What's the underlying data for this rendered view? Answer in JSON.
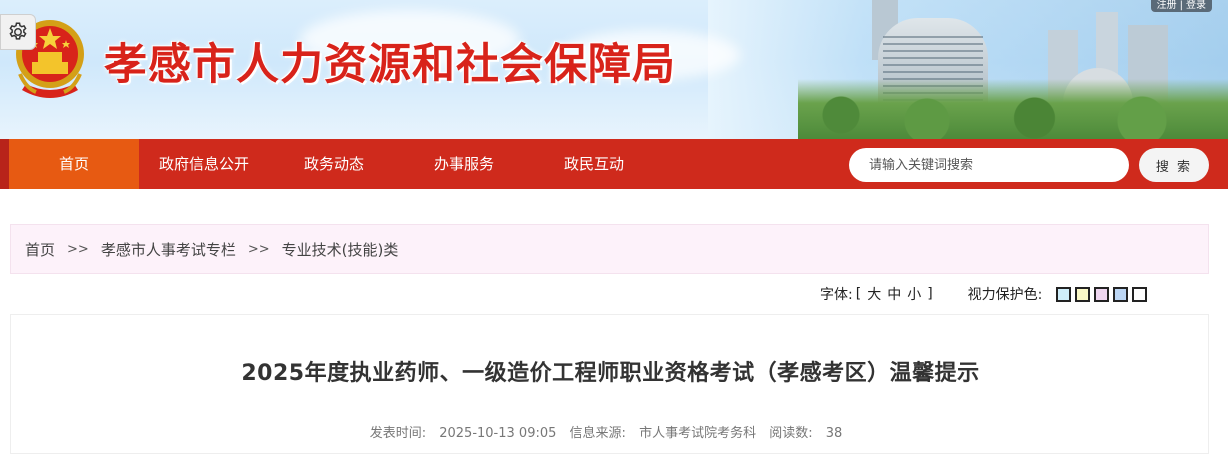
{
  "header": {
    "site_title": "孝感市人力资源和社会保障局",
    "account": {
      "register": "注册",
      "separator": "|",
      "login": "登录"
    },
    "gear_icon": "gear-icon",
    "emblem_icon": "national-emblem-icon"
  },
  "nav": {
    "items": [
      {
        "label": "首页",
        "active": true
      },
      {
        "label": "政府信息公开",
        "active": false
      },
      {
        "label": "政务动态",
        "active": false
      },
      {
        "label": "办事服务",
        "active": false
      },
      {
        "label": "政民互动",
        "active": false
      }
    ],
    "search_placeholder": "请输入关键词搜索",
    "search_button": "搜 索"
  },
  "breadcrumb": {
    "items": [
      "首页",
      "孝感市人事考试专栏",
      "专业技术(技能)类"
    ],
    "separator": ">>"
  },
  "tools": {
    "font_label": "字体:",
    "bracket_open": "[",
    "sizes": [
      "大",
      "中",
      "小"
    ],
    "bracket_close": "]",
    "eye_label": "视力保护色:",
    "swatches": [
      "#cfeefa",
      "#fbf9c6",
      "#efd6f0",
      "#bcd6f4",
      "#ffffff"
    ]
  },
  "article": {
    "title": "2025年度执业药师、一级造价工程师职业资格考试（孝感考区）温馨提示",
    "publish_label": "发表时间:",
    "publish_time": "2025-10-13 09:05",
    "source_label": "信息来源:",
    "source": "市人事考试院考务科",
    "reads_label": "阅读数:",
    "reads": "38"
  },
  "colors": {
    "brand_red": "#cf2a1c",
    "nav_active": "#e75a12",
    "title_red": "#d8231a",
    "breadcrumb_bg": "#fdf2fa"
  }
}
